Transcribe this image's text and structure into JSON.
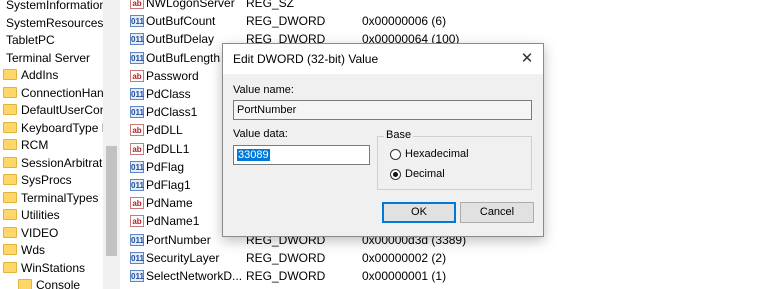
{
  "tree": {
    "roots": [
      "SystemInformation",
      "SystemResources",
      "TabletPC",
      "Terminal Server"
    ],
    "children": [
      "AddIns",
      "ConnectionHan",
      "DefaultUserCon",
      "KeyboardType N",
      "RCM",
      "SessionArbitrati",
      "SysProcs",
      "TerminalTypes",
      "Utilities",
      "VIDEO",
      "Wds",
      "WinStations"
    ],
    "grandchild": "Console"
  },
  "values": [
    {
      "name": "NWLogonServer",
      "type": "REG_SZ",
      "data": "",
      "kind": "sz"
    },
    {
      "name": "OutBufCount",
      "type": "REG_DWORD",
      "data": "0x00000006 (6)",
      "kind": "dword"
    },
    {
      "name": "OutBufDelay",
      "type": "REG_DWORD",
      "data": "0x00000064 (100)",
      "kind": "dword"
    },
    {
      "name": "OutBufLength",
      "type": "",
      "data": "",
      "kind": "dword"
    },
    {
      "name": "Password",
      "type": "",
      "data": "",
      "kind": "sz"
    },
    {
      "name": "PdClass",
      "type": "",
      "data": "",
      "kind": "dword"
    },
    {
      "name": "PdClass1",
      "type": "",
      "data": "",
      "kind": "dword"
    },
    {
      "name": "PdDLL",
      "type": "",
      "data": "",
      "kind": "sz"
    },
    {
      "name": "PdDLL1",
      "type": "",
      "data": "",
      "kind": "sz"
    },
    {
      "name": "PdFlag",
      "type": "",
      "data": "",
      "kind": "dword"
    },
    {
      "name": "PdFlag1",
      "type": "",
      "data": "",
      "kind": "dword"
    },
    {
      "name": "PdName",
      "type": "",
      "data": "",
      "kind": "sz"
    },
    {
      "name": "PdName1",
      "type": "",
      "data": "",
      "kind": "sz"
    },
    {
      "name": "PortNumber",
      "type": "REG_DWORD",
      "data": "0x00000d3d (3389)",
      "kind": "dword"
    },
    {
      "name": "SecurityLayer",
      "type": "REG_DWORD",
      "data": "0x00000002 (2)",
      "kind": "dword"
    },
    {
      "name": "SelectNetworkD...",
      "type": "REG_DWORD",
      "data": "0x00000001 (1)",
      "kind": "dword"
    }
  ],
  "icons": {
    "dword_glyph": "011",
    "sz_glyph": "ab"
  },
  "dialog": {
    "title": "Edit DWORD (32-bit) Value",
    "close_glyph": "✕",
    "value_name_label": "Value name:",
    "value_name": "PortNumber",
    "value_data_label": "Value data:",
    "value_data": "33089",
    "base_label": "Base",
    "hex_label": "Hexadecimal",
    "dec_label": "Decimal",
    "selected_base": "Decimal",
    "ok_label": "OK",
    "cancel_label": "Cancel"
  },
  "colors": {
    "selection": "#0078d7",
    "folder": "#ffd768"
  }
}
